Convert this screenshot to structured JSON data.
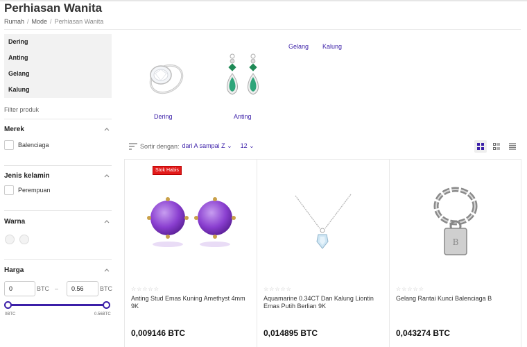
{
  "page": {
    "title": "Perhiasan Wanita"
  },
  "breadcrumb": [
    "Rumah",
    "Mode",
    "Perhiasan Wanita"
  ],
  "sidebar": {
    "categories": [
      {
        "label": "Dering"
      },
      {
        "label": "Anting"
      },
      {
        "label": "Gelang"
      },
      {
        "label": "Kalung"
      }
    ],
    "filter_label": "Filter produk",
    "brand": {
      "title": "Merek",
      "options": [
        "Balenciaga"
      ]
    },
    "gender": {
      "title": "Jenis kelamin",
      "options": [
        "Perempuan"
      ]
    },
    "color": {
      "title": "Warna"
    },
    "price": {
      "title": "Harga",
      "min_value": "0",
      "max_value": "0.56",
      "unit": "BTC",
      "separator": "–",
      "range_min_label": "0BTC",
      "range_max_label": "0.56BTC",
      "slider_low": 0,
      "slider_high": 1
    }
  },
  "subcategories": [
    {
      "label": "Dering",
      "icon": "ring-image"
    },
    {
      "label": "Anting",
      "icon": "earrings-image"
    },
    {
      "label": "Gelang"
    },
    {
      "label": "Kalung"
    }
  ],
  "toolbar": {
    "sort_label": "Sortir dengan:",
    "sort_value": "dari A sampai Z",
    "per_page": "12",
    "views": [
      "grid-view-icon",
      "list-grid-view-icon",
      "list-view-icon"
    ]
  },
  "products": [
    {
      "badge": "Stok Habis",
      "stars": "☆☆☆☆☆",
      "name": "Anting Stud Emas Kuning Amethyst 4mm 9K",
      "price": "0,009146 BTC"
    },
    {
      "badge": "",
      "stars": "☆☆☆☆☆",
      "name": "Aquamarine 0.34CT Dan Kalung Liontin Emas Putih Berlian 9K",
      "price": "0,014895 BTC"
    },
    {
      "badge": "",
      "stars": "☆☆☆☆☆",
      "name": "Gelang Rantai Kunci Balenciaga B",
      "price": "0,043274 BTC"
    }
  ],
  "colors": {
    "accent": "#3b1fa8",
    "badge": "#e21b1b"
  }
}
